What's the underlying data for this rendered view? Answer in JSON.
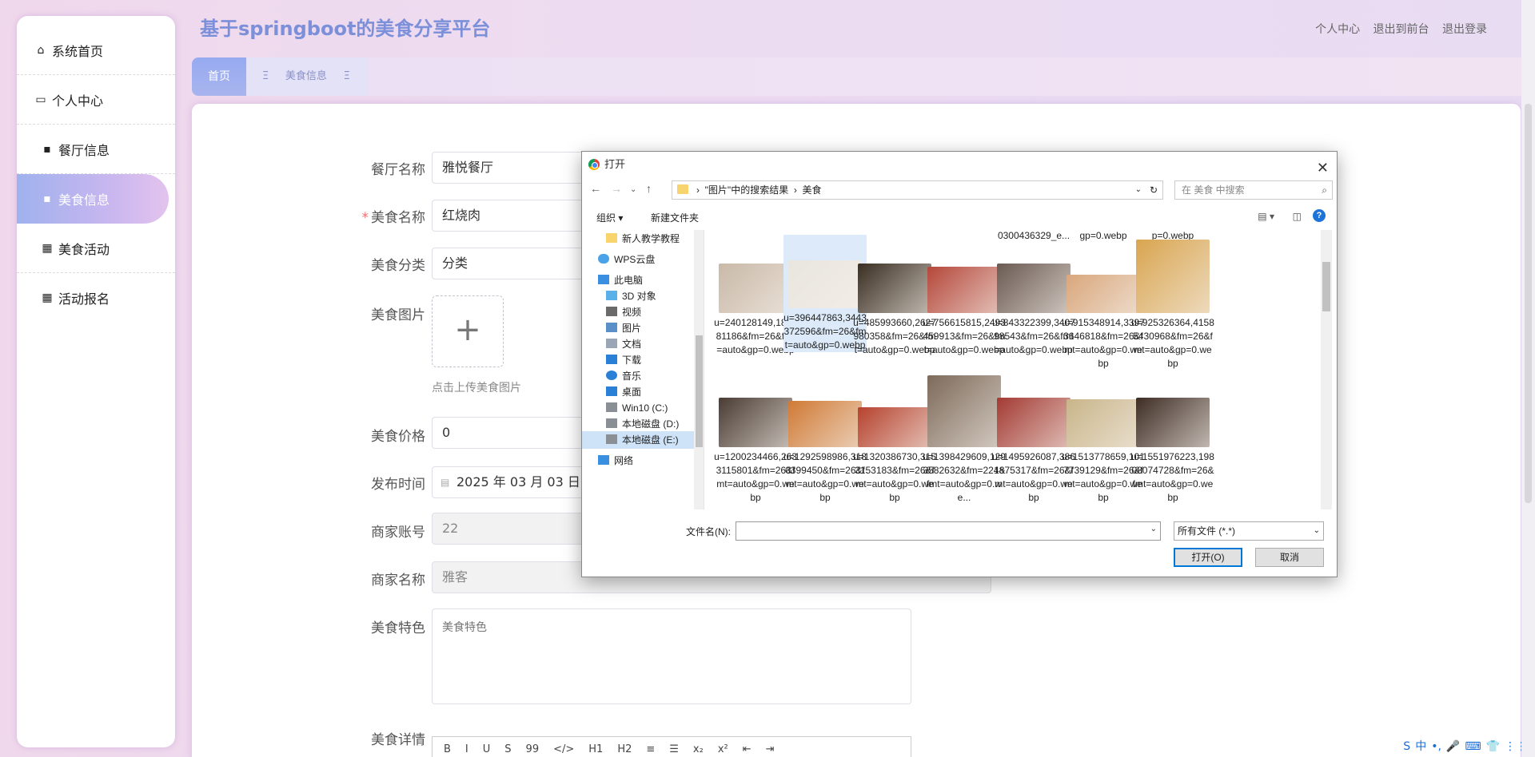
{
  "app": {
    "title": "基于springboot的美食分享平台"
  },
  "topnav": {
    "profile": "个人中心",
    "front": "退出到前台",
    "logout": "退出登录"
  },
  "sidebar": {
    "items": [
      {
        "label": "系统首页",
        "icon": "home-icon"
      },
      {
        "label": "个人中心",
        "icon": "profile-icon"
      },
      {
        "label": "餐厅信息",
        "icon": "store-icon"
      },
      {
        "label": "美食信息",
        "icon": "bag-icon"
      },
      {
        "label": "美食活动",
        "icon": "grid-icon"
      },
      {
        "label": "活动报名",
        "icon": "grid-icon"
      }
    ]
  },
  "tabs": {
    "home": "首页",
    "food": "美食信息",
    "mark": "Ξ"
  },
  "form": {
    "restaurant_label": "餐厅名称",
    "restaurant_value": "雅悦餐厅",
    "name_label": "美食名称",
    "name_value": "红烧肉",
    "category_label": "美食分类",
    "category_value": "分类",
    "image_label": "美食图片",
    "image_hint": "点击上传美食图片",
    "upload_plus": "+",
    "price_label": "美食价格",
    "price_value": "0",
    "time_label": "发布时间",
    "time_value": "2025 年 03 月 03 日",
    "merchant_account_label": "商家账号",
    "merchant_account_value": "22",
    "merchant_name_label": "商家名称",
    "merchant_name_value": "雅客",
    "feature_label": "美食特色",
    "feature_placeholder": "美食特色",
    "detail_label": "美食详情",
    "required_mark": "*",
    "editor_tools": [
      "B",
      "I",
      "U",
      "S",
      "99",
      "</>",
      "H1",
      "H2",
      "≡",
      "☰",
      "x₂",
      "x²",
      "⇤",
      "⇥"
    ]
  },
  "dialog": {
    "title": "打开",
    "path": [
      "\"图片\"中的搜索结果",
      "美食"
    ],
    "search_placeholder": "在 美食 中搜索",
    "organize": "组织 ▾",
    "new_folder": "新建文件夹",
    "nav_items": [
      {
        "label": "新人教学教程",
        "icon": "folder-icon"
      },
      {
        "label": "WPS云盘",
        "icon": "cloud-icon"
      },
      {
        "label": "此电脑",
        "icon": "computer-icon"
      },
      {
        "label": "3D 对象",
        "icon": "cube-icon"
      },
      {
        "label": "视频",
        "icon": "video-icon"
      },
      {
        "label": "图片",
        "icon": "picture-icon"
      },
      {
        "label": "文档",
        "icon": "document-icon"
      },
      {
        "label": "下载",
        "icon": "download-icon"
      },
      {
        "label": "音乐",
        "icon": "music-icon"
      },
      {
        "label": "桌面",
        "icon": "desktop-icon"
      },
      {
        "label": "Win10 (C:)",
        "icon": "drive-icon"
      },
      {
        "label": "本地磁盘 (D:)",
        "icon": "drive-icon"
      },
      {
        "label": "本地磁盘 (E:)",
        "icon": "drive-icon"
      },
      {
        "label": "网络",
        "icon": "network-icon"
      }
    ],
    "top_partial": [
      "0300436329_e...",
      "gp=0.webp",
      "p=0.webp"
    ],
    "files_row1": [
      {
        "name": "u=240128149,182381186&fm=26&fmt=auto&gp=0.webp",
        "color": "#c9b9a8"
      },
      {
        "name": "u=396447863,3443372596&fm=26&fmt=auto&gp=0.webp",
        "color": "#e9e6df"
      },
      {
        "name": "u=485993660,2627980358&fm=26&fmt=auto&gp=0.webp",
        "color": "#3a2e22"
      },
      {
        "name": "u=756615815,2493459913&fm=26&fmt=auto&gp=0.webp",
        "color": "#b5473a"
      },
      {
        "name": "u=843322399,340798543&fm=26&fmt=auto&gp=0.webp",
        "color": "#6a5a52"
      },
      {
        "name": "u=915348914,33973646818&fm=26&fmt=auto&gp=0.webp",
        "color": "#d9a77c"
      },
      {
        "name": "u=925326364,41585430968&fm=26&fmt=auto&gp=0.webp",
        "color": "#d9a550"
      }
    ],
    "files_row2": [
      {
        "name": "u=1200234466,2633115801&fm=26&fmt=auto&gp=0.webp",
        "color": "#4a3c34"
      },
      {
        "name": "u=1292598986,3180399450&fm=26&fmt=auto&gp=0.webp",
        "color": "#d07a35"
      },
      {
        "name": "u=1320386730,3153153183&fm=26&fmt=auto&gp=0.webp",
        "color": "#b6422e"
      },
      {
        "name": "u=1398429609,1293582632&fm=224&fmt=auto&gp=0.we...",
        "color": "#7d6a5a"
      },
      {
        "name": "u=1495926087,3861875317&fm=26&fmt=auto&gp=0.webp",
        "color": "#a33a33"
      },
      {
        "name": "u=1513778659,1017739129&fm=26&fmt=auto&gp=0.webp",
        "color": "#c9b58a"
      },
      {
        "name": "u=1551976223,19808074728&fm=26&fmt=auto&gp=0.webp",
        "color": "#3d2c24"
      }
    ],
    "filename_label": "文件名(N):",
    "filetype": "所有文件 (*.*)",
    "open_button": "打开(O)",
    "cancel_button": "取消"
  },
  "tray": [
    "S",
    "中",
    "•,",
    "🎤",
    "⌨",
    "👕",
    "⋮⋮"
  ],
  "colors": {
    "brand": "#7c8fd9",
    "accent": "#9fb2ee",
    "required": "#f56c6c"
  }
}
